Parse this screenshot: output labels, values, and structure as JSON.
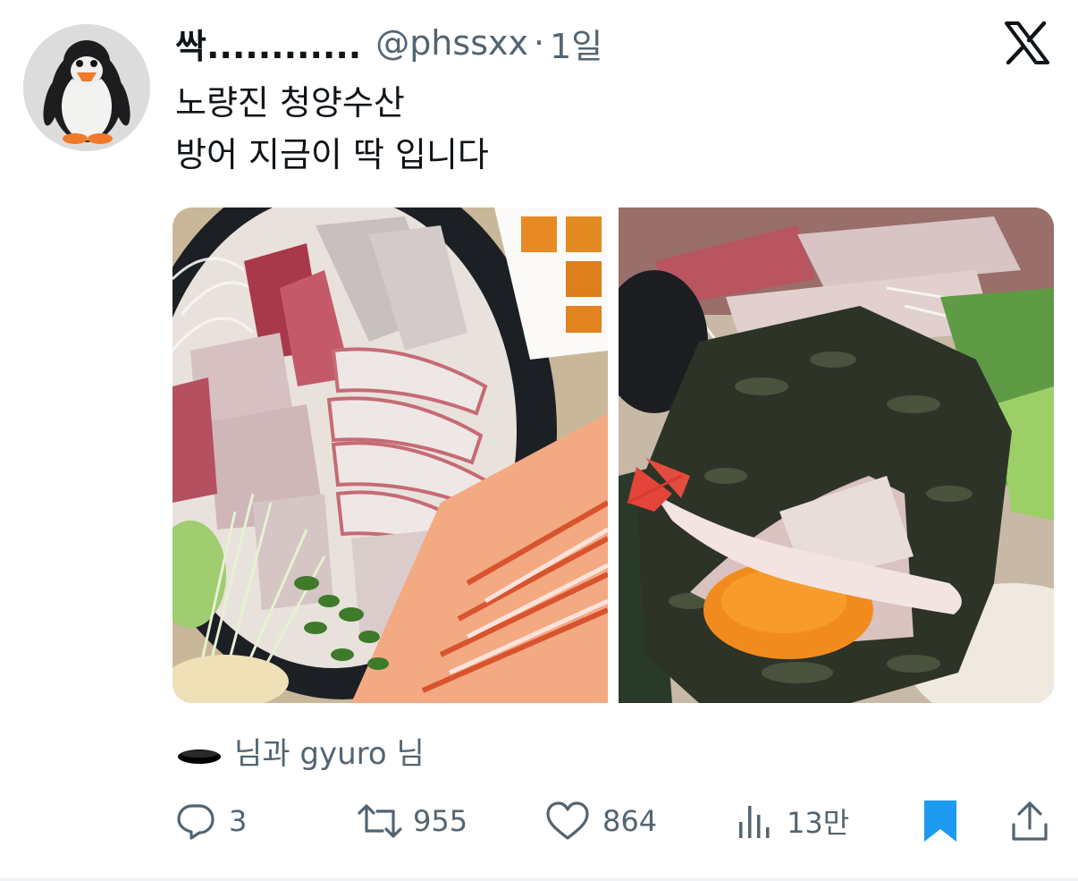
{
  "tweet": {
    "display_name": "싹............",
    "handle": "@phssxx",
    "separator": "·",
    "time": "1일",
    "lines": [
      "노량진 청양수산",
      "방어 지금이 딱 입니다"
    ]
  },
  "tagged": {
    "text": "님과 gyuro 님"
  },
  "actions": {
    "replies": "3",
    "retweets": "955",
    "likes": "864",
    "views": "13만"
  },
  "colors": {
    "text_primary": "#0f1419",
    "text_secondary": "#536471",
    "bookmark_active": "#1d9bf0"
  },
  "icons": [
    "x-logo-icon",
    "reply-icon",
    "retweet-icon",
    "like-icon",
    "views-icon",
    "bookmark-icon",
    "share-icon"
  ]
}
